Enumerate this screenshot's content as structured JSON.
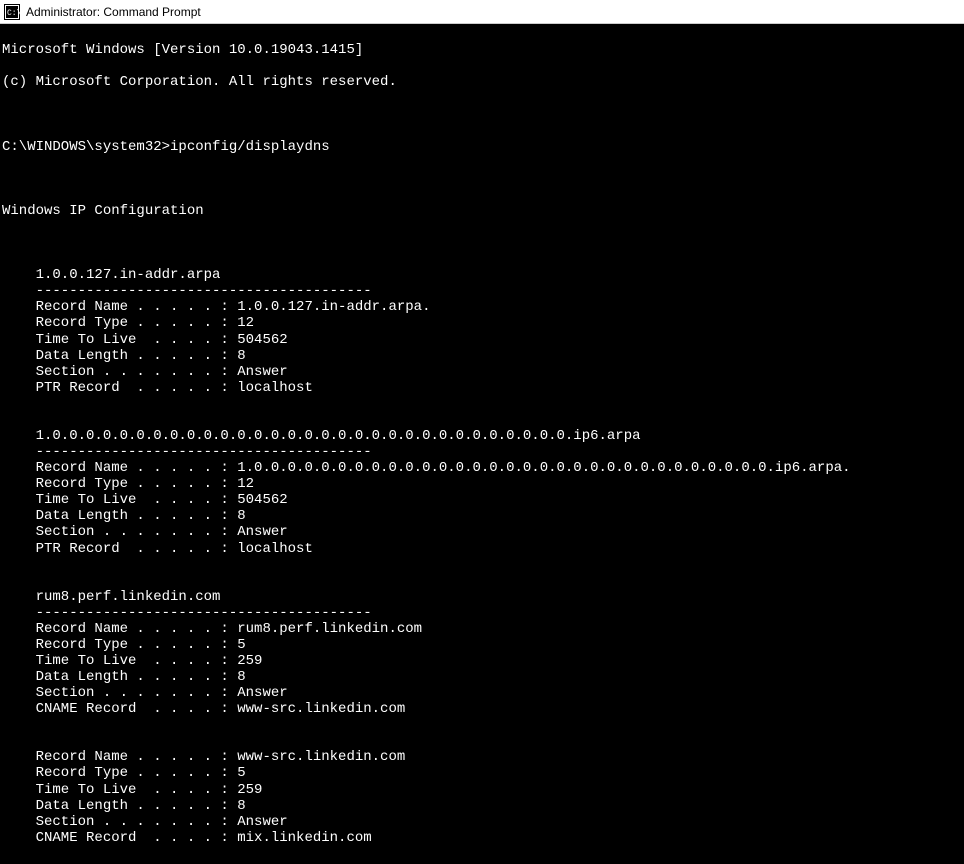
{
  "window": {
    "title": "Administrator: Command Prompt"
  },
  "header": {
    "line1": "Microsoft Windows [Version 10.0.19043.1415]",
    "line2": "(c) Microsoft Corporation. All rights reserved."
  },
  "prompt": {
    "path": "C:\\WINDOWS\\system32>",
    "command": "ipconfig/displaydns"
  },
  "section_title": "Windows IP Configuration",
  "entries": [
    {
      "header": "    1.0.0.127.in-addr.arpa",
      "divider": "    ----------------------------------------",
      "fields": [
        "    Record Name . . . . . : 1.0.0.127.in-addr.arpa.",
        "    Record Type . . . . . : 12",
        "    Time To Live  . . . . : 504562",
        "    Data Length . . . . . : 8",
        "    Section . . . . . . . : Answer",
        "    PTR Record  . . . . . : localhost"
      ]
    },
    {
      "header": "    1.0.0.0.0.0.0.0.0.0.0.0.0.0.0.0.0.0.0.0.0.0.0.0.0.0.0.0.0.0.0.0.ip6.arpa",
      "divider": "    ----------------------------------------",
      "fields": [
        "    Record Name . . . . . : 1.0.0.0.0.0.0.0.0.0.0.0.0.0.0.0.0.0.0.0.0.0.0.0.0.0.0.0.0.0.0.0.ip6.arpa.",
        "    Record Type . . . . . : 12",
        "    Time To Live  . . . . : 504562",
        "    Data Length . . . . . : 8",
        "    Section . . . . . . . : Answer",
        "    PTR Record  . . . . . : localhost"
      ]
    },
    {
      "header": "    rum8.perf.linkedin.com",
      "divider": "    ----------------------------------------",
      "fields": [
        "    Record Name . . . . . : rum8.perf.linkedin.com",
        "    Record Type . . . . . : 5",
        "    Time To Live  . . . . : 259",
        "    Data Length . . . . . : 8",
        "    Section . . . . . . . : Answer",
        "    CNAME Record  . . . . : www-src.linkedin.com"
      ]
    },
    {
      "header": "",
      "divider": "",
      "fields": [
        "    Record Name . . . . . : www-src.linkedin.com",
        "    Record Type . . . . . : 5",
        "    Time To Live  . . . . : 259",
        "    Data Length . . . . . : 8",
        "    Section . . . . . . . : Answer",
        "    CNAME Record  . . . . : mix.linkedin.com"
      ]
    }
  ]
}
